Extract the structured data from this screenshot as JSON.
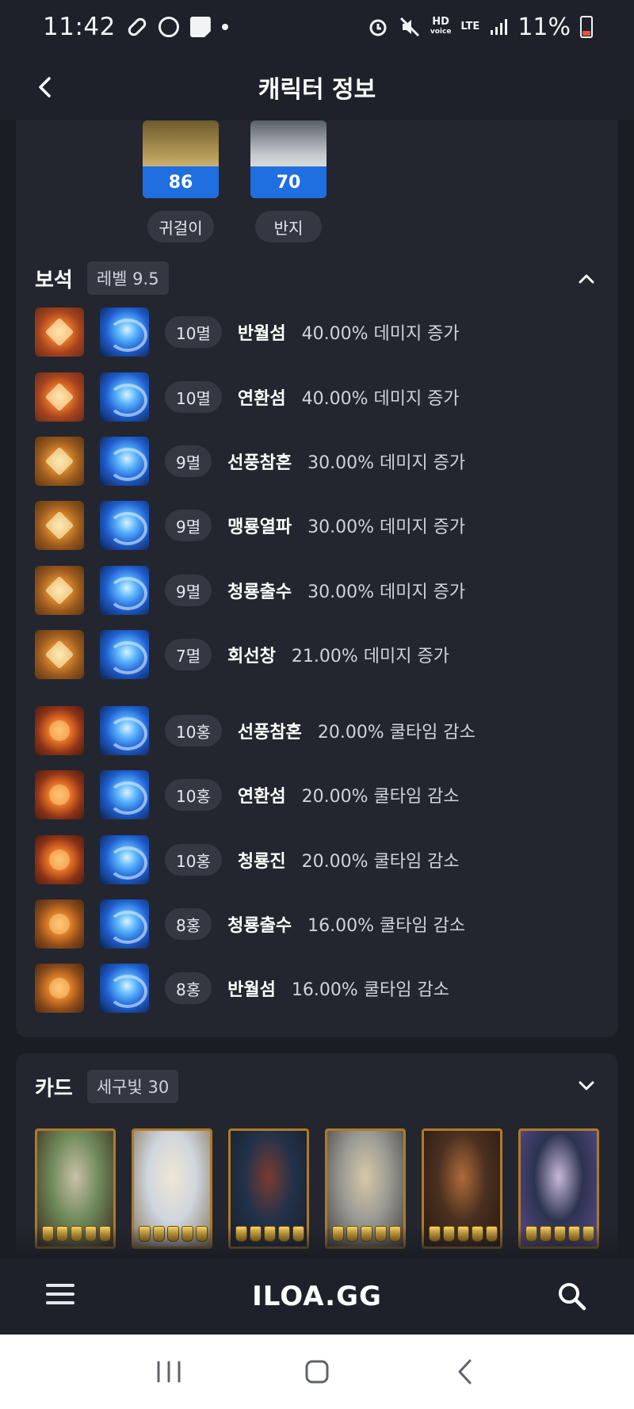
{
  "status_bar": {
    "time": "11:42",
    "hd_label": "HD",
    "hd_sub": "voice",
    "lte_label": "LTE",
    "battery": "11%"
  },
  "header": {
    "title": "캐릭터 정보"
  },
  "accessories": [
    {
      "level": "86",
      "label": "귀걸이"
    },
    {
      "level": "70",
      "label": "반지"
    }
  ],
  "gems": {
    "title": "보석",
    "badge": "레벨 9.5",
    "items": [
      {
        "grade": "10멸",
        "skill": "반월섬",
        "effect": "40.00% 데미지 증가",
        "kind": "dmg"
      },
      {
        "grade": "10멸",
        "skill": "연환섬",
        "effect": "40.00% 데미지 증가",
        "kind": "dmg"
      },
      {
        "grade": "9멸",
        "skill": "선풍참혼",
        "effect": "30.00% 데미지 증가",
        "kind": "dmg-low"
      },
      {
        "grade": "9멸",
        "skill": "맹룡열파",
        "effect": "30.00% 데미지 증가",
        "kind": "dmg-low"
      },
      {
        "grade": "9멸",
        "skill": "청룡출수",
        "effect": "30.00% 데미지 증가",
        "kind": "dmg-low"
      },
      {
        "grade": "7멸",
        "skill": "회선창",
        "effect": "21.00% 데미지 증가",
        "kind": "dmg-low"
      },
      {
        "grade": "10홍",
        "skill": "선풍참혼",
        "effect": "20.00% 쿨타임 감소",
        "kind": "cd"
      },
      {
        "grade": "10홍",
        "skill": "연환섬",
        "effect": "20.00% 쿨타임 감소",
        "kind": "cd"
      },
      {
        "grade": "10홍",
        "skill": "청룡진",
        "effect": "20.00% 쿨타임 감소",
        "kind": "cd"
      },
      {
        "grade": "8홍",
        "skill": "청룡출수",
        "effect": "16.00% 쿨타임 감소",
        "kind": "cd-low"
      },
      {
        "grade": "8홍",
        "skill": "반월섬",
        "effect": "16.00% 쿨타임 감소",
        "kind": "cd-low"
      }
    ]
  },
  "cards": {
    "title": "카드",
    "badge": "세구빛 30",
    "items": [
      {
        "awakening": 5,
        "tone": [
          "#6f8a5a",
          "#c8c0a8",
          "#3c2d22"
        ]
      },
      {
        "awakening": 5,
        "tone": [
          "#cfd6de",
          "#f0e6d4",
          "#8a7a64"
        ]
      },
      {
        "awakening": 5,
        "tone": [
          "#22324a",
          "#7a3b30",
          "#1a1f2a"
        ]
      },
      {
        "awakening": 5,
        "tone": [
          "#9a9a94",
          "#d8c8a8",
          "#4a4640"
        ]
      },
      {
        "awakening": 5,
        "tone": [
          "#4a3020",
          "#b06a3a",
          "#2a1a10"
        ]
      },
      {
        "awakening": 5,
        "tone": [
          "#2c3350",
          "#c8b8d8",
          "#5a4a8a"
        ]
      }
    ]
  },
  "bottom_bar": {
    "logo": "ILOA.GG"
  }
}
